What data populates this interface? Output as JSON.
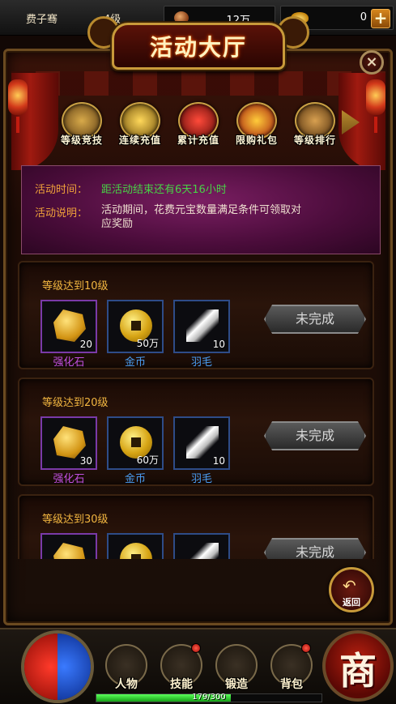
{
  "topbar": {
    "player_name": "费子骞",
    "level": "4级",
    "copper": "12万",
    "ingot": "0",
    "add_label": "+"
  },
  "window": {
    "title": "活动大厅",
    "close_label": "×"
  },
  "tabs": [
    {
      "label": "等级竞技",
      "icon": "lion-head-icon",
      "color": "#8a6a2a"
    },
    {
      "label": "连续充值",
      "icon": "gold-pot-icon",
      "color": "#a07a18"
    },
    {
      "label": "累计充值",
      "icon": "red-pouch-icon",
      "color": "#a0181a"
    },
    {
      "label": "限购礼包",
      "icon": "gift-box-icon",
      "color": "#c09018"
    },
    {
      "label": "等级排行",
      "icon": "armor-helmet-icon",
      "color": "#7a5a2a"
    }
  ],
  "info": {
    "time_label": "活动时间：",
    "time_value": "距活动结束还有6天16小时",
    "desc_label": "活动说明：",
    "desc_line1": "活动期间，花费元宝数量满足条件可领取对",
    "desc_line2": "应奖励"
  },
  "rewards": [
    {
      "title": "等级达到10级",
      "items": [
        {
          "name": "强化石",
          "count": "20",
          "icon": "strengthen-stone-icon",
          "rarity": "purple"
        },
        {
          "name": "金币",
          "count": "50万",
          "icon": "gold-coin-icon",
          "rarity": "blue"
        },
        {
          "name": "羽毛",
          "count": "10",
          "icon": "feather-icon",
          "rarity": "blue"
        }
      ],
      "status": "未完成"
    },
    {
      "title": "等级达到20级",
      "items": [
        {
          "name": "强化石",
          "count": "30",
          "icon": "strengthen-stone-icon",
          "rarity": "purple"
        },
        {
          "name": "金币",
          "count": "60万",
          "icon": "gold-coin-icon",
          "rarity": "blue"
        },
        {
          "name": "羽毛",
          "count": "10",
          "icon": "feather-icon",
          "rarity": "blue"
        }
      ],
      "status": "未完成"
    },
    {
      "title": "等级达到30级",
      "items": [
        {
          "name": "",
          "count": "",
          "icon": "strengthen-stone-icon",
          "rarity": "purple"
        },
        {
          "name": "",
          "count": "",
          "icon": "gold-coin-icon",
          "rarity": "blue"
        },
        {
          "name": "",
          "count": "",
          "icon": "feather-icon",
          "rarity": "blue"
        }
      ],
      "status": "未完成"
    }
  ],
  "back": {
    "label": "返回"
  },
  "bottom_nav": [
    {
      "label": "人物",
      "icon": "character-icon",
      "badge": false
    },
    {
      "label": "技能",
      "icon": "skill-book-icon",
      "badge": true
    },
    {
      "label": "锻造",
      "icon": "anvil-icon",
      "badge": false
    },
    {
      "label": "背包",
      "icon": "backpack-icon",
      "badge": true
    }
  ],
  "shop": {
    "label": "商"
  },
  "xp": {
    "text": "179/300",
    "fraction": 0.597
  }
}
